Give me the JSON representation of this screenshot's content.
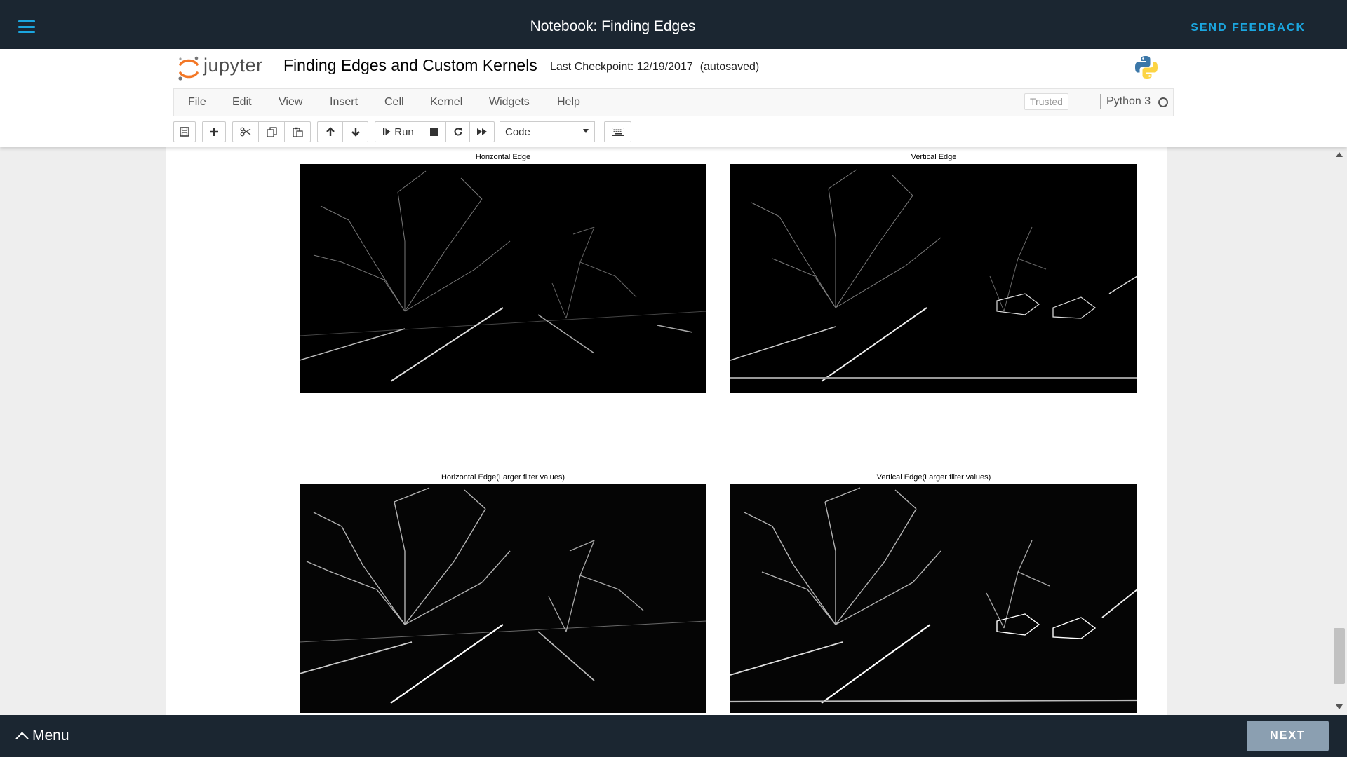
{
  "topbar": {
    "title": "Notebook: Finding Edges",
    "feedback_label": "SEND FEEDBACK"
  },
  "header": {
    "logo_text": "jupyter",
    "notebook_name": "Finding Edges and Custom Kernels",
    "checkpoint": "Last Checkpoint: 12/19/2017",
    "autosave": "(autosaved)"
  },
  "menubar": {
    "items": [
      "File",
      "Edit",
      "View",
      "Insert",
      "Cell",
      "Kernel",
      "Widgets",
      "Help"
    ],
    "trusted": "Trusted",
    "kernel": "Python 3"
  },
  "toolbar": {
    "icons": [
      "save-icon",
      "plus-icon",
      "cut-icon",
      "copy-icon",
      "paste-icon",
      "arrow-up-icon",
      "arrow-down-icon",
      "step-forward-icon",
      "stop-icon",
      "restart-icon",
      "fast-forward-icon",
      "keyboard-icon"
    ],
    "run_label": "Run",
    "cell_type": "Code"
  },
  "plots": [
    {
      "title": "Horizontal Edge"
    },
    {
      "title": "Vertical Edge"
    },
    {
      "title": "Horizontal Edge(Larger filter values)"
    },
    {
      "title": "Vertical Edge(Larger filter values)"
    }
  ],
  "bottombar": {
    "menu_label": "Menu",
    "next_label": "NEXT"
  },
  "colors": {
    "dark_bar": "#1b2631",
    "accent": "#1ba6df",
    "next_button": "#8b9fb1"
  }
}
